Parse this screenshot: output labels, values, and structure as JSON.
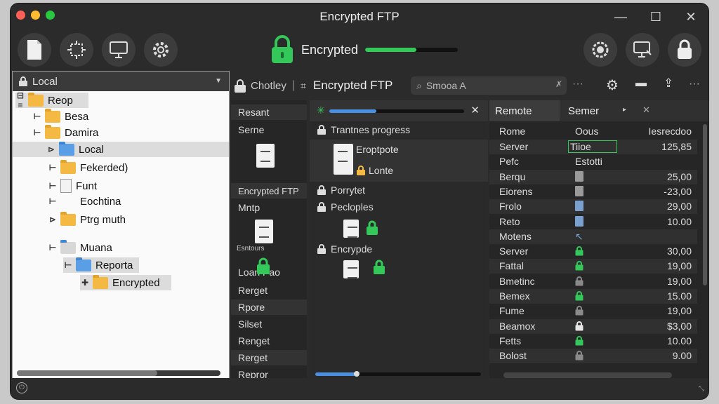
{
  "window": {
    "title": "Encrypted FTP"
  },
  "toolbar": {
    "encrypted_label": "Encrypted",
    "encryption_progress": 0.55,
    "accent": "#34c759"
  },
  "local": {
    "title": "Local",
    "tree": [
      {
        "label": "Reop",
        "icon": "folder-icon",
        "selected": true
      },
      {
        "label": "Besa",
        "icon": "folder-icon"
      },
      {
        "label": "Damira",
        "icon": "folder-icon"
      },
      {
        "label": "Local",
        "icon": "folder-blue-icon",
        "selected": true
      },
      {
        "label": "Fekerded)",
        "icon": "folder-icon"
      },
      {
        "label": "Funt",
        "icon": "file-icon"
      },
      {
        "label": "Eochtina",
        "icon": ""
      },
      {
        "label": "Ptrg muth",
        "icon": "folder-icon"
      },
      {
        "label": "Muana",
        "icon": "image-folder-icon"
      },
      {
        "label": "Reporta",
        "icon": "folder-blue-icon"
      },
      {
        "label": "Encrypted",
        "icon": "folder-icon"
      }
    ]
  },
  "pathbar": {
    "user": "Chotley",
    "title": "Encrypted FTP",
    "search_value": "Smooa A"
  },
  "middle_list": [
    "Resant",
    "Serne",
    "Encrypted FTP",
    "Mntp",
    "Loan Pao",
    "Rerget",
    "Rpore",
    "Silset",
    "Renget",
    "Rerget",
    "Repror"
  ],
  "middle_icons": {
    "doc1_label": "Esntours"
  },
  "transfer": {
    "top_progress": 0.35,
    "header": "Trantnes progress",
    "file1_name": "Eroptpote",
    "file1_sub": "Lonte",
    "item2": "Porrytet",
    "item3": "Pecloples",
    "item4": "Encrypde",
    "bottom_progress": 0.25
  },
  "remote": {
    "tabs": [
      "Remote",
      "Semer"
    ],
    "columns": [
      "Rome",
      "Oous",
      "Iesrecdoo"
    ],
    "rows": [
      {
        "name": "Server",
        "type": "Tiioe",
        "size": "125,85"
      },
      {
        "name": "Pefc",
        "type": "Estotti",
        "size": ""
      },
      {
        "name": "Berqu",
        "type": "doc",
        "size": "25,00"
      },
      {
        "name": "Eiorens",
        "type": "doc",
        "size": "-23,00"
      },
      {
        "name": "Frolo",
        "type": "doc-blue",
        "size": "29,00"
      },
      {
        "name": "Reto",
        "type": "doc-blue",
        "size": "10.00"
      },
      {
        "name": "Motens",
        "type": "link",
        "size": ""
      },
      {
        "name": "Server",
        "type": "lock",
        "size": "30,00"
      },
      {
        "name": "Fattal",
        "type": "lock",
        "size": "19,00"
      },
      {
        "name": "Bmetinc",
        "type": "lock-grey",
        "size": "19,00"
      },
      {
        "name": "Bemex",
        "type": "lock",
        "size": "15.00"
      },
      {
        "name": "Fume",
        "type": "lock-grey",
        "size": "19,00"
      },
      {
        "name": "Beamox",
        "type": "lock-white",
        "size": "$3,00"
      },
      {
        "name": "Fetts",
        "type": "lock",
        "size": "10.00"
      },
      {
        "name": "Bolost",
        "type": "lock-grey",
        "size": "9.00"
      }
    ]
  }
}
